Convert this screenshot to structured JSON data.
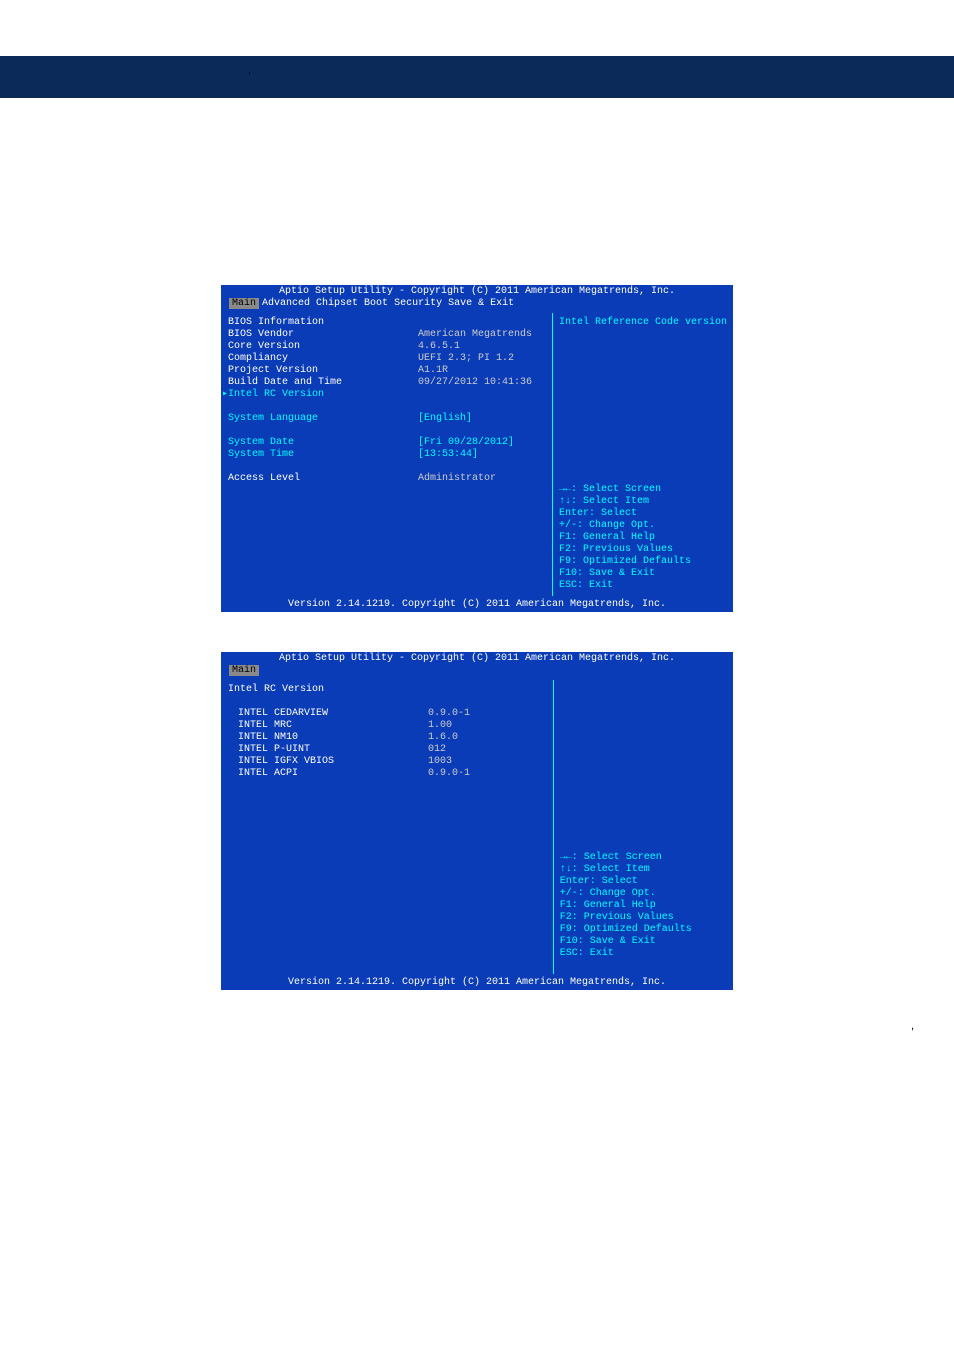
{
  "doc": {
    "apostrophe": ","
  },
  "bios1": {
    "title": "Aptio Setup Utility - Copyright (C) 2011 American Megatrends, Inc.",
    "tabs": [
      "Main",
      "Advanced",
      "Chipset",
      "Boot",
      "Security",
      "Save & Exit"
    ],
    "activeTab": "Main",
    "rows": [
      {
        "label": "BIOS Information",
        "value": "",
        "labelClass": "white"
      },
      {
        "label": "BIOS Vendor",
        "value": "American Megatrends",
        "labelClass": "white"
      },
      {
        "label": "Core Version",
        "value": "4.6.5.1",
        "labelClass": "white"
      },
      {
        "label": "Compliancy",
        "value": "UEFI 2.3; PI 1.2",
        "labelClass": "white"
      },
      {
        "label": "Project Version",
        "value": "A1.1R",
        "labelClass": "white"
      },
      {
        "label": "Build Date and Time",
        "value": "09/27/2012 10:41:36",
        "labelClass": "white"
      },
      {
        "label": "Intel RC Version",
        "value": "",
        "labelClass": "cyan",
        "arrow": true
      }
    ],
    "rows2": [
      {
        "label": "System Language",
        "value": "[English]",
        "labelClass": "cyan",
        "valueClass": "cyan"
      }
    ],
    "rows3": [
      {
        "label": "System Date",
        "value": "[Fri 09/28/2012]",
        "labelClass": "cyan",
        "valueClass": "cyan"
      },
      {
        "label": "System Time",
        "value": "[13:53:44]",
        "labelClass": "cyan",
        "valueClass": "cyan"
      }
    ],
    "rows4": [
      {
        "label": "Access Level",
        "value": "Administrator",
        "labelClass": "white"
      }
    ],
    "helpTop": "Intel Reference Code version",
    "helpKeys": [
      "→←: Select Screen",
      "↑↓: Select Item",
      "Enter: Select",
      "+/-: Change Opt.",
      "F1: General Help",
      "F2: Previous Values",
      "F9: Optimized Defaults",
      "F10: Save & Exit",
      "ESC: Exit"
    ],
    "footer": "Version 2.14.1219. Copyright (C) 2011 American Megatrends, Inc."
  },
  "bios2": {
    "title": "Aptio Setup Utility - Copyright (C) 2011 American Megatrends, Inc.",
    "tabs": [
      "Main"
    ],
    "activeTab": "Main",
    "header": "Intel RC Version",
    "rows": [
      {
        "label": "INTEL CEDARVIEW",
        "value": "0.9.0-1"
      },
      {
        "label": "INTEL MRC",
        "value": "1.00"
      },
      {
        "label": "INTEL NM10",
        "value": "1.6.0"
      },
      {
        "label": "INTEL P-UINT",
        "value": "012"
      },
      {
        "label": "INTEL IGFX VBIOS",
        "value": "1003"
      },
      {
        "label": "INTEL ACPI",
        "value": "0.9.0-1"
      }
    ],
    "helpKeys": [
      "→←: Select Screen",
      "↑↓: Select Item",
      "Enter: Select",
      "+/-: Change Opt.",
      "F1: General Help",
      "F2: Previous Values",
      "F9: Optimized Defaults",
      "F10: Save & Exit",
      "ESC: Exit"
    ],
    "footer": "Version 2.14.1219. Copyright (C) 2011 American Megatrends, Inc."
  }
}
